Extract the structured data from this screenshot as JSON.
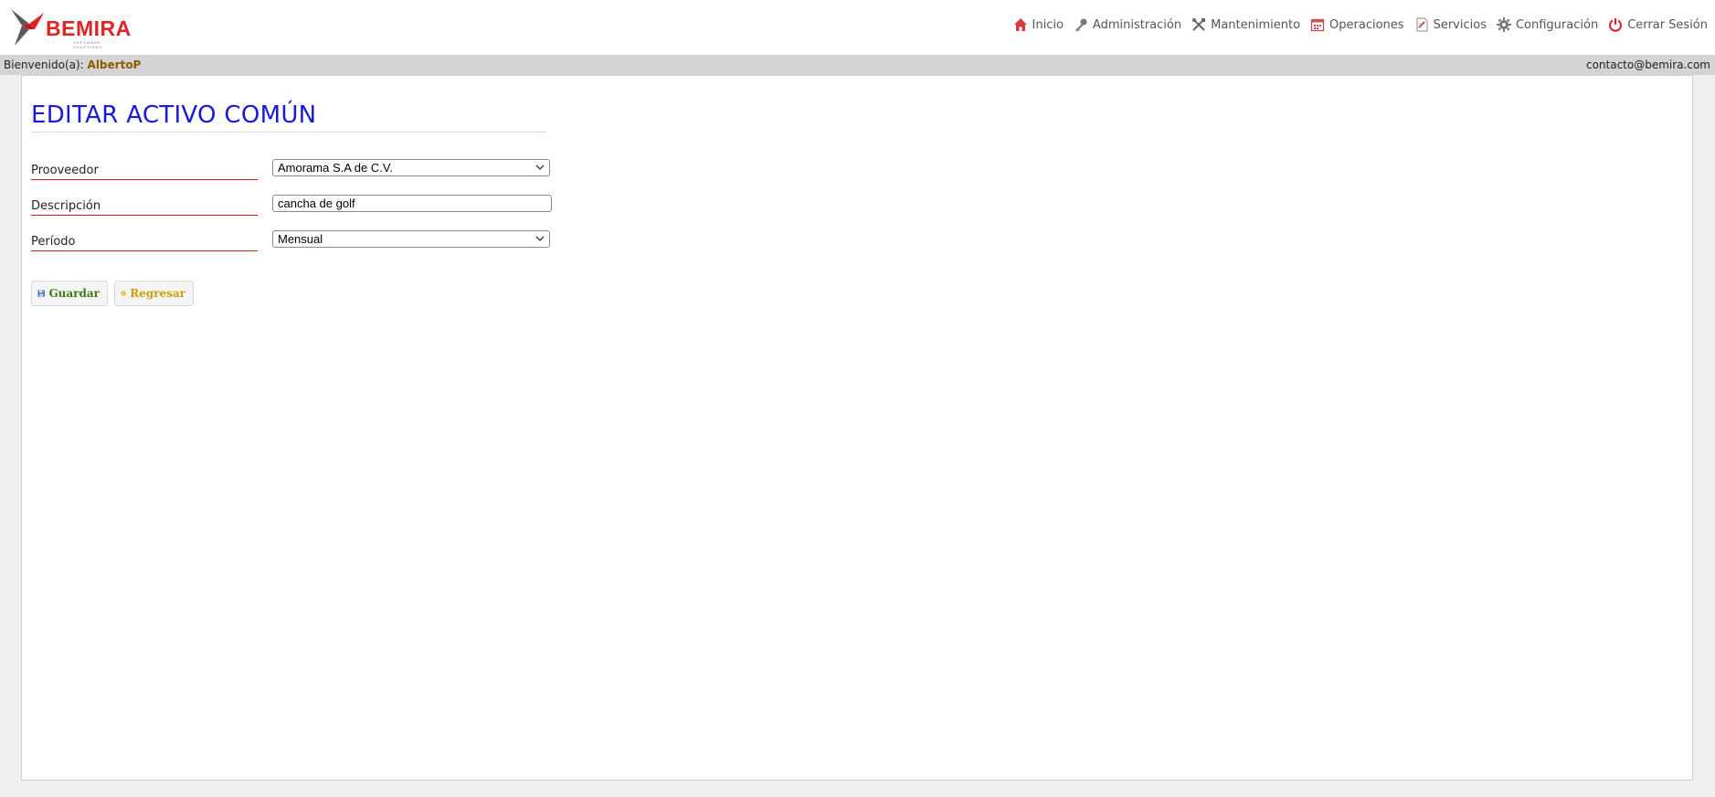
{
  "header": {
    "logo_text": "BEMIRA",
    "logo_subtext": "SOFTWARE SOLUTIONS",
    "nav": [
      {
        "label": "Inicio",
        "icon": "home-icon"
      },
      {
        "label": "Administración",
        "icon": "key-icon"
      },
      {
        "label": "Mantenimiento",
        "icon": "tools-icon"
      },
      {
        "label": "Operaciones",
        "icon": "calendar-icon"
      },
      {
        "label": "Servicios",
        "icon": "document-icon"
      },
      {
        "label": "Configuración",
        "icon": "gear-icon"
      },
      {
        "label": "Cerrar Sesión",
        "icon": "power-icon"
      }
    ]
  },
  "welcome": {
    "prefix": "Bienvenido(a):",
    "user": "AlbertoP",
    "contact": "contacto@bemira.com"
  },
  "form": {
    "title": "EDITAR ACTIVO COMÚN",
    "fields": [
      {
        "label": "Prooveedor",
        "type": "select",
        "value": "Amorama S.A de C.V."
      },
      {
        "label": "Descripción",
        "type": "text",
        "value": "cancha de golf"
      },
      {
        "label": "Período",
        "type": "select",
        "value": "Mensual"
      }
    ],
    "buttons": {
      "save_label": "Guardar",
      "back_label": "Regresar"
    }
  },
  "colors": {
    "title": "#1a1ad6",
    "label_rule": "#d42020",
    "user_name": "#8a5a00",
    "save_text": "#3c7a12",
    "back_text": "#c8a000"
  }
}
